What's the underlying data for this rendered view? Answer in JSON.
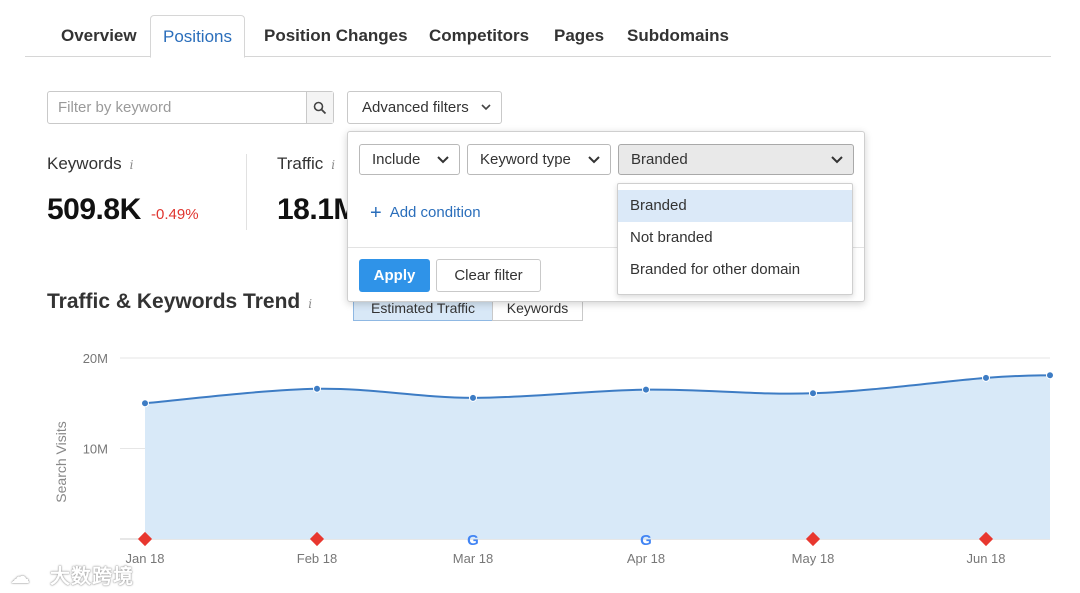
{
  "tabs": [
    {
      "label": "Overview",
      "active": false
    },
    {
      "label": "Positions",
      "active": true
    },
    {
      "label": "Position Changes",
      "active": false
    },
    {
      "label": "Competitors",
      "active": false
    },
    {
      "label": "Pages",
      "active": false
    },
    {
      "label": "Subdomains",
      "active": false
    }
  ],
  "filter": {
    "search_placeholder": "Filter by keyword",
    "advanced_label": "Advanced filters"
  },
  "kpis": {
    "keywords": {
      "label": "Keywords",
      "value": "509.8K",
      "change": "-0.49%"
    },
    "traffic": {
      "label": "Traffic",
      "value": "18.1M"
    }
  },
  "trend": {
    "title": "Traffic & Keywords Trend",
    "toggle": [
      "Estimated Traffic",
      "Keywords"
    ]
  },
  "popup": {
    "include": "Include",
    "keyword_type": "Keyword type",
    "value": "Branded",
    "add_condition": "Add condition",
    "apply": "Apply",
    "clear": "Clear filter",
    "options": [
      "Branded",
      "Not branded",
      "Branded for other domain"
    ]
  },
  "chart_data": {
    "type": "area",
    "ylabel": "Search Visits",
    "y_ticks": [
      "20M",
      "10M"
    ],
    "ylim": [
      0,
      20000000
    ],
    "grid": true,
    "x": [
      "Jan 18",
      "Feb 18",
      "Mar 18",
      "Apr 18",
      "May 18",
      "Jun 18"
    ],
    "series": [
      {
        "values": [
          15000000,
          16600000,
          15600000,
          16500000,
          16100000,
          17800000,
          18100000
        ]
      }
    ],
    "markers": [
      "diamond",
      "diamond",
      "google",
      "google",
      "diamond",
      "diamond"
    ],
    "colors": {
      "line": "#3d7cc4",
      "fill": "#d8e9f8",
      "marker": "#e8372f"
    }
  },
  "watermark": "大数跨境"
}
